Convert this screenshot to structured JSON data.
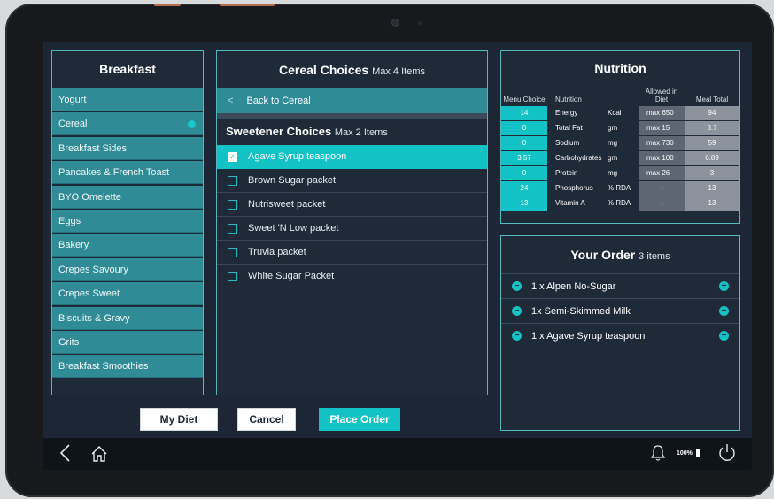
{
  "breakfast": {
    "title": "Breakfast",
    "items": [
      {
        "label": "Yogurt"
      },
      {
        "label": "Cereal",
        "selected": true
      },
      {
        "label": "Breakfast Sides"
      },
      {
        "label": "Pancakes & French Toast"
      },
      {
        "label": "BYO Omelette"
      },
      {
        "label": "Eggs"
      },
      {
        "label": "Bakery"
      },
      {
        "label": "Crepes Savoury"
      },
      {
        "label": "Crepes Sweet"
      },
      {
        "label": "Biscuits & Gravy"
      },
      {
        "label": "Grits"
      },
      {
        "label": "Breakfast Smoothies"
      }
    ]
  },
  "cereal": {
    "title": "Cereal Choices",
    "subtitle": "Max 4 Items",
    "back_label": "Back to Cereal",
    "sweetener_title": "Sweetener Choices",
    "sweetener_subtitle": "Max 2 Items",
    "choices": [
      {
        "label": "Agave Syrup teaspoon",
        "checked": true
      },
      {
        "label": "Brown Sugar packet",
        "checked": false
      },
      {
        "label": "Nutrisweet packet",
        "checked": false
      },
      {
        "label": "Sweet 'N Low packet",
        "checked": false
      },
      {
        "label": "Truvia packet",
        "checked": false
      },
      {
        "label": "White Sugar Packet",
        "checked": false
      }
    ]
  },
  "nutrition": {
    "title": "Nutrition",
    "headers": {
      "menu_choice": "Menu Choice",
      "nutrition": "Nutrition",
      "allowed": "Allowed in Diet",
      "total": "Meal Total"
    },
    "rows": [
      {
        "menu": "14",
        "name": "Energy",
        "unit": "Kcal",
        "allowed": "max 650",
        "total": "94"
      },
      {
        "menu": "0",
        "name": "Total Fat",
        "unit": "gm",
        "allowed": "max 15",
        "total": "3.7"
      },
      {
        "menu": "0",
        "name": "Sodium",
        "unit": "mg",
        "allowed": "max 730",
        "total": "59"
      },
      {
        "menu": "3.57",
        "name": "Carbohydrates",
        "unit": "gm",
        "allowed": "max 100",
        "total": "6.89"
      },
      {
        "menu": "0",
        "name": "Protein",
        "unit": "mg",
        "allowed": "max 26",
        "total": "3"
      },
      {
        "menu": "24",
        "name": "Phosphorus",
        "unit": "% RDA",
        "allowed": "–",
        "total": "13"
      },
      {
        "menu": "13",
        "name": "Vitamin A",
        "unit": "% RDA",
        "allowed": "–",
        "total": "13"
      }
    ]
  },
  "order": {
    "title": "Your Order",
    "count_label": "3 items",
    "items": [
      {
        "label": "1 x Alpen No-Sugar"
      },
      {
        "label": "1x Semi-Skimmed Milk"
      },
      {
        "label": "1 x Agave Syrup teaspoon"
      }
    ]
  },
  "buttons": {
    "my_diet": "My Diet",
    "cancel": "Cancel",
    "place_order": "Place Order"
  },
  "status": {
    "battery": "100%"
  },
  "colors": {
    "accent": "#13c2c4",
    "category_bg": "#2f8c97",
    "panel_bg": "#1f2a39"
  }
}
